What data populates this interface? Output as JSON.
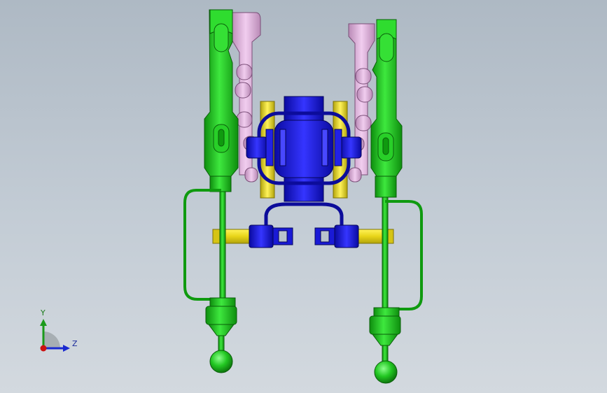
{
  "viewport": {
    "background_top": "#aeb9c4",
    "background_bottom": "#d3d9df"
  },
  "colors": {
    "green": "#22c722",
    "green_dark": "#0f7d0f",
    "pink": "#e3b6df",
    "pink_dark": "#8a5a88",
    "yellow": "#f0e020",
    "yellow_dark": "#8a7e08",
    "blue": "#1a1ad6",
    "blue_dark": "#08086e"
  },
  "triad": {
    "y_label": "Y",
    "z_label": "Z",
    "x_color": "#cc1111",
    "y_color": "#1b9a1b",
    "z_color": "#1a2ad0"
  }
}
